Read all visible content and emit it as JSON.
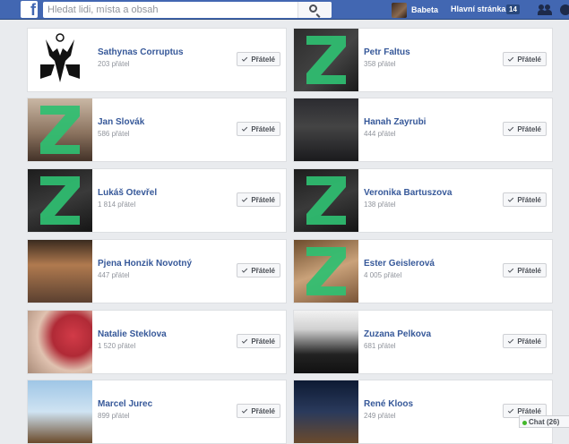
{
  "topbar": {
    "logo": "f",
    "search_placeholder": "Hledat lidi, místa a obsah",
    "user_name": "Babeta",
    "home_label": "Hlavní stránka",
    "home_badge": "14"
  },
  "friend_button_label": "Přátelé",
  "friends": [
    {
      "name": "Sathynas Corruptus",
      "count": "203 přátel",
      "photo": "baphomet-drawing",
      "z": false
    },
    {
      "name": "Petr Faltus",
      "count": "358 přátel",
      "photo": "green-z-logo",
      "z": true
    },
    {
      "name": "Jan Slovák",
      "count": "586 přátel",
      "photo": "man-with-green-z",
      "z": true
    },
    {
      "name": "Hanah Zayrubi",
      "count": "444 přátel",
      "photo": "masked-person",
      "z": false
    },
    {
      "name": "Lukáš Otevřel",
      "count": "1 814 přátel",
      "photo": "dark-green-z",
      "z": true
    },
    {
      "name": "Veronika Bartuszova",
      "count": "138 přátel",
      "photo": "dark-green-z",
      "z": true
    },
    {
      "name": "Pjena Honzik Novotný",
      "count": "447 přátel",
      "photo": "man-with-sunglasses",
      "z": false
    },
    {
      "name": "Ester Geislerová",
      "count": "4 005 přátel",
      "photo": "woman-with-green-z",
      "z": true
    },
    {
      "name": "Natalie Steklova",
      "count": "1 520 přátel",
      "photo": "woman-polka-dot-scarf",
      "z": false
    },
    {
      "name": "Zuzana Pelkova",
      "count": "681 přátel",
      "photo": "woman-black-white",
      "z": false
    },
    {
      "name": "Marcel Jurec",
      "count": "899 přátel",
      "photo": "paraglider",
      "z": false
    },
    {
      "name": "René Kloos",
      "count": "249 přátel",
      "photo": "man-city-night",
      "z": false
    }
  ],
  "chat": {
    "label": "Chat (26)"
  }
}
